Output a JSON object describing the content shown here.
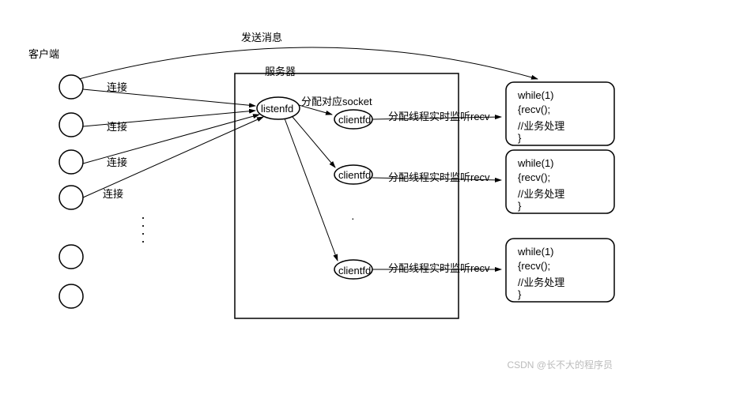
{
  "labels": {
    "client_header": "客户端",
    "server_header": "服务器",
    "send_msg": "发送消息",
    "connect": "连接",
    "listenfd": "listenfd",
    "assign_socket": "分配对应socket",
    "clientfd": "clientfd",
    "assign_thread": "分配线程实时监听recv",
    "code_while": "while(1)",
    "code_recv": "{recv();",
    "code_biz": "//业务处理",
    "code_end": "}",
    "dots": "⋮"
  },
  "watermark": "CSDN @长不大的程序员"
}
